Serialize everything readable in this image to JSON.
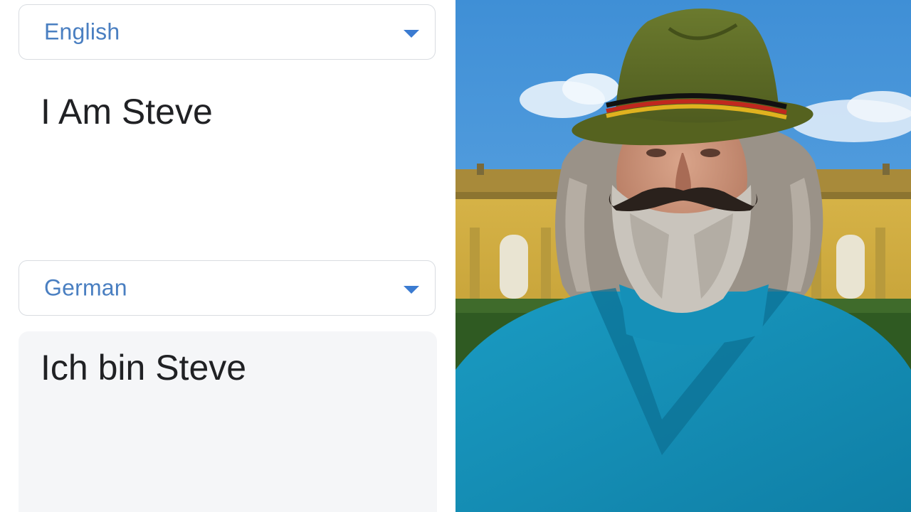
{
  "translator": {
    "source_language": "English",
    "source_text": "I Am Steve",
    "target_language": "German",
    "translated_text": "Ich bin Steve"
  },
  "icons": {
    "source_caret": "chevron-down-icon",
    "target_caret": "chevron-down-icon"
  },
  "colors": {
    "language_label": "#4a7fc1",
    "caret": "#3b7bd1",
    "output_background": "#f5f6f8",
    "text": "#202124"
  }
}
